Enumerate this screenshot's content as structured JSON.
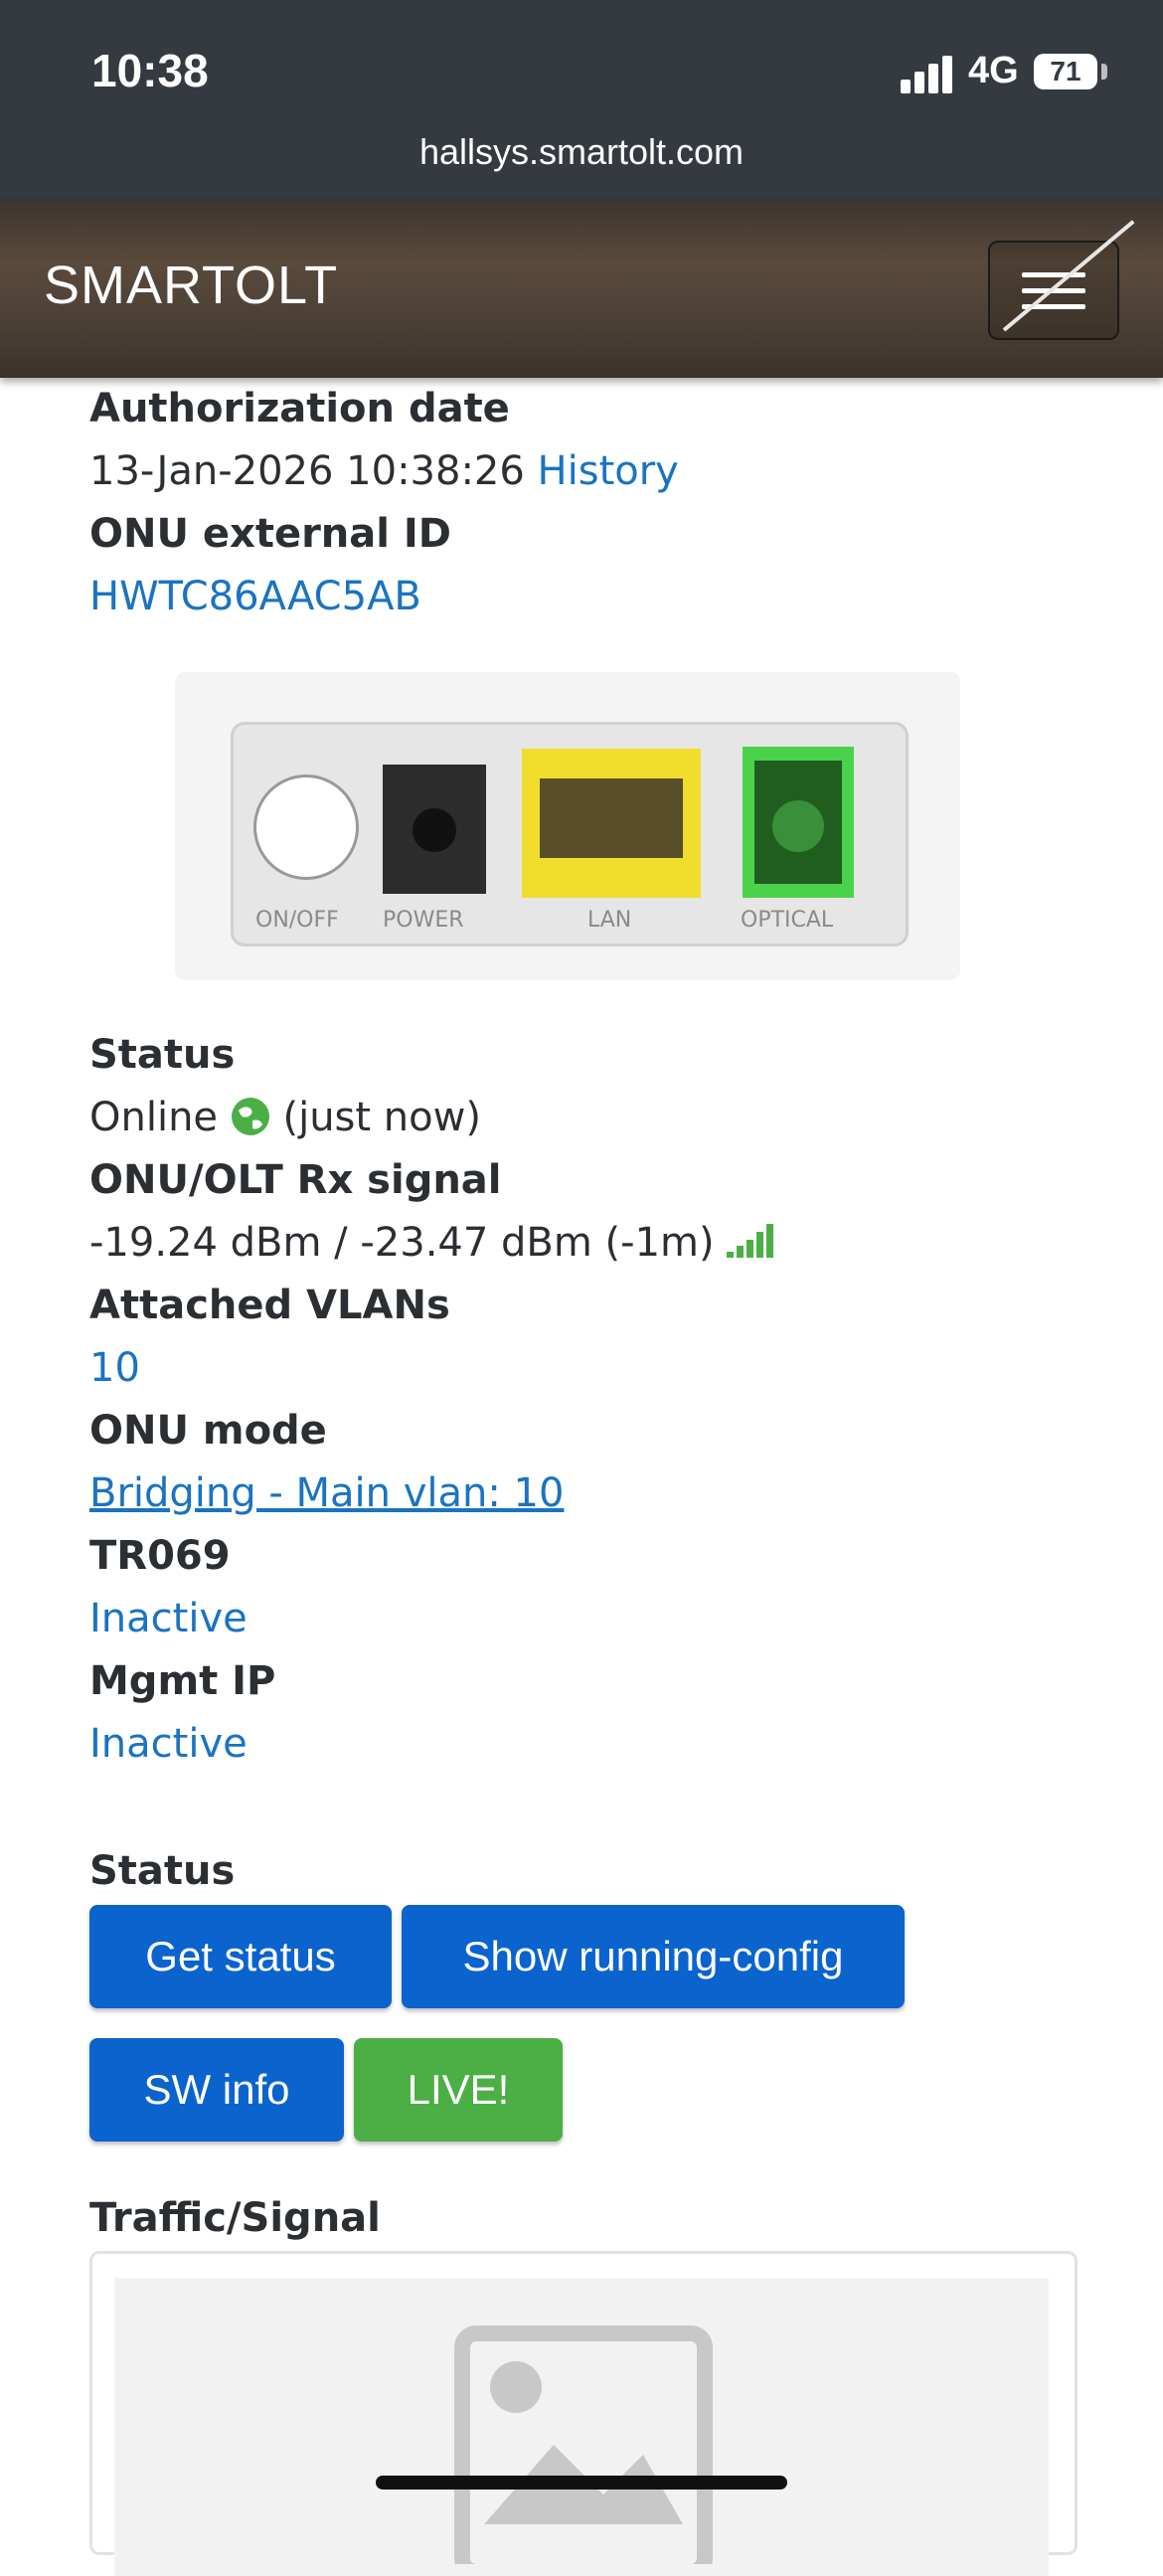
{
  "status_bar": {
    "time": "10:38",
    "network": "4G",
    "battery": "71"
  },
  "browser": {
    "url": "hallsys.smartolt.com"
  },
  "navbar": {
    "brand": "SMARTOLT"
  },
  "details": {
    "authorization_date_label": "Authorization date",
    "authorization_date_value": "13-Jan-2026 10:38:26",
    "history_link": "History",
    "external_id_label": "ONU external ID",
    "external_id_value": "HWTC86AAC5AB",
    "device_ports": [
      "ON/OFF",
      "POWER",
      "LAN",
      "OPTICAL"
    ],
    "status_label": "Status",
    "status_value": "Online",
    "status_time": "(just now)",
    "rx_signal_label": "ONU/OLT Rx signal",
    "rx_signal_value": "-19.24 dBm / -23.47 dBm (-1m)",
    "vlans_label": "Attached VLANs",
    "vlans_value": "10",
    "onu_mode_label": "ONU mode",
    "onu_mode_value": "Bridging - Main vlan: 10",
    "tr069_label": "TR069",
    "tr069_value": "Inactive",
    "mgmt_ip_label": "Mgmt IP",
    "mgmt_ip_value": "Inactive"
  },
  "actions": {
    "section_label": "Status",
    "get_status": "Get status",
    "show_running_config": "Show running-config",
    "sw_info": "SW info",
    "live": "LIVE!"
  },
  "traffic": {
    "label": "Traffic/Signal"
  },
  "colors": {
    "link": "#1a73c2",
    "button_blue": "#0b63ce",
    "button_green": "#4caf46",
    "online": "#4caf46"
  }
}
